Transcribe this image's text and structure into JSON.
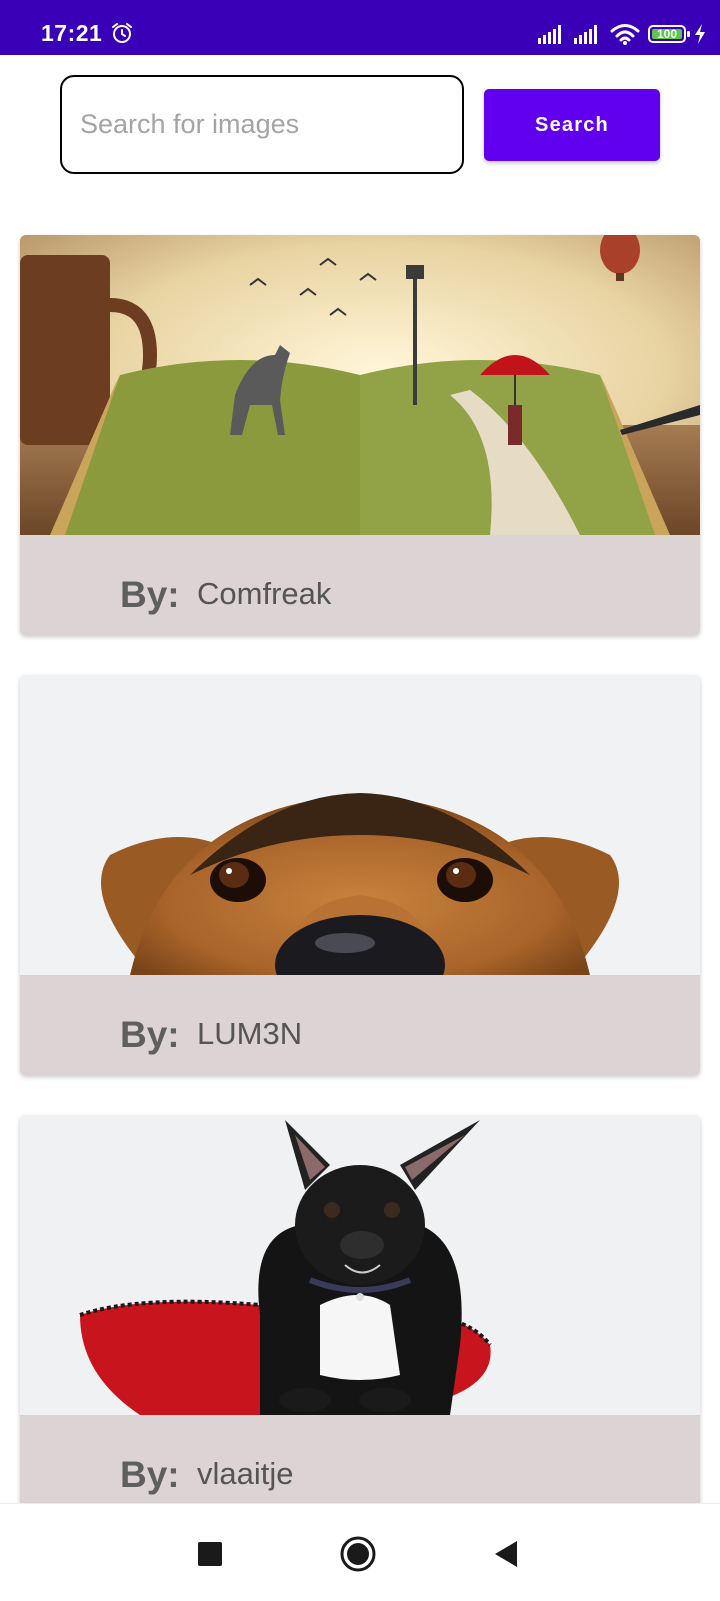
{
  "status_bar": {
    "time": "17:21",
    "battery_level": "100",
    "icons": [
      "alarm-icon",
      "signal-icon",
      "signal-icon",
      "wifi-icon",
      "battery-icon",
      "charging-icon"
    ]
  },
  "search": {
    "placeholder": "Search for images",
    "value": "",
    "button_label": "Search"
  },
  "colors": {
    "status_bar": "#3a00b8",
    "accent": "#6100ee",
    "caption_bg": "#dcd4d4"
  },
  "results": [
    {
      "by_label": "By:",
      "author": "Comfreak",
      "image": "book-landscape-image"
    },
    {
      "by_label": "By:",
      "author": "LUM3N",
      "image": "dog-face-image"
    },
    {
      "by_label": "By:",
      "author": "vlaaitje",
      "image": "french-bulldog-image"
    }
  ],
  "nav_bar": {
    "icons": [
      "recents-square-icon",
      "home-circle-icon",
      "back-triangle-icon"
    ]
  }
}
